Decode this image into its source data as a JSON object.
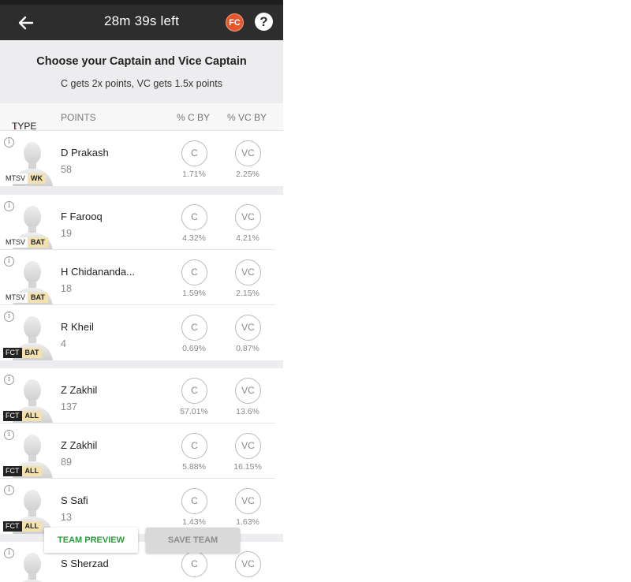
{
  "header": {
    "timer": "28m 39s left",
    "logo_text": "FC",
    "help_symbol": "?",
    "back_icon": "arrow-left-icon"
  },
  "intro": {
    "title": "Choose your Captain and Vice Captain",
    "subtitle": "C gets 2x points, VC gets 1.5x points"
  },
  "columns": {
    "type": "TYPE",
    "points": "POINTS",
    "c_by": "% C BY",
    "vc_by": "% VC BY"
  },
  "buttons": {
    "c_label": "C",
    "vc_label": "VC"
  },
  "players": [
    {
      "name": "D Prakash",
      "points": "58",
      "team": "MTSV",
      "role": "WK",
      "c_pct": "1.71%",
      "vc_pct": "2.25%"
    },
    {
      "name": "F Farooq",
      "points": "19",
      "team": "MTSV",
      "role": "BAT",
      "c_pct": "4.32%",
      "vc_pct": "4.21%"
    },
    {
      "name": "H Chidananda...",
      "points": "18",
      "team": "MTSV",
      "role": "BAT",
      "c_pct": "1.59%",
      "vc_pct": "2.15%"
    },
    {
      "name": "R Kheil",
      "points": "4",
      "team": "FCT",
      "role": "BAT",
      "c_pct": "0.69%",
      "vc_pct": "0.87%"
    },
    {
      "name": "Z Zakhil",
      "points": "137",
      "team": "FCT",
      "role": "ALL",
      "c_pct": "57.01%",
      "vc_pct": "13.6%"
    },
    {
      "name": "Z Zakhil",
      "points": "89",
      "team": "FCT",
      "role": "ALL",
      "c_pct": "5.88%",
      "vc_pct": "16.15%"
    },
    {
      "name": "S Safi",
      "points": "13",
      "team": "FCT",
      "role": "ALL",
      "c_pct": "1.43%",
      "vc_pct": "1.63%"
    },
    {
      "name": "S Sherzad",
      "points": "",
      "team": "",
      "role": "",
      "c_pct": "",
      "vc_pct": ""
    }
  ],
  "footer": {
    "preview_label": "TEAM PREVIEW",
    "save_label": "SAVE TEAM"
  },
  "colors": {
    "header_bg": "#2d2d2d",
    "preview_text": "#2e9b3e",
    "sort_arrow": "#d32f2f",
    "role_badge": "#f3e2b0"
  }
}
